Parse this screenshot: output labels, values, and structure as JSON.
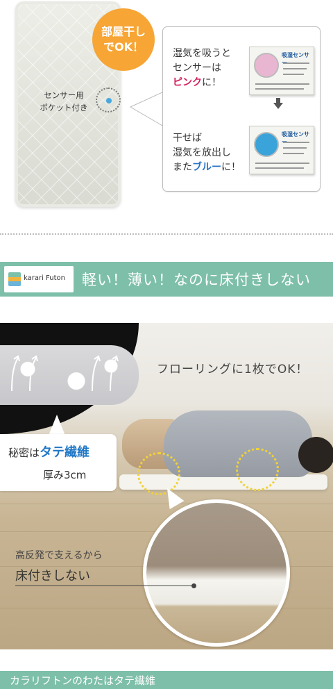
{
  "top": {
    "badge_line1": "部屋干し",
    "badge_line2": "でOK！",
    "pocket_label_line1": "センサー用",
    "pocket_label_line2": "ポケット付き",
    "bubble": {
      "wet_line1": "湿気を吸うと",
      "wet_line2": "センサーは",
      "wet_line3_colored": "ピンク",
      "wet_line3_suffix": "に！",
      "dry_line1": "干せば",
      "dry_line2": "湿気を放出し",
      "dry_line3_prefix": "また",
      "dry_line3_colored": "ブルー",
      "dry_line3_suffix": "に！",
      "sensor_title": "吸湿センサー",
      "pink_color": "#e9b6d1",
      "blue_color": "#3aa3d9"
    }
  },
  "banner": {
    "logo_text": "karari Futon",
    "title": "軽い！薄い！なのに床付きしない",
    "color": "#7ebfa9"
  },
  "photo": {
    "caption_flooring": "フローリングに1枚でOK！",
    "secret_prefix": "秘密は",
    "secret_highlight": "タテ繊維",
    "thickness": "厚み3cm",
    "support_caption": "高反発で支えるから",
    "no_bed_caption": "床付きしない"
  },
  "footer": {
    "title": "カラリフトンのわたはタテ繊維"
  }
}
